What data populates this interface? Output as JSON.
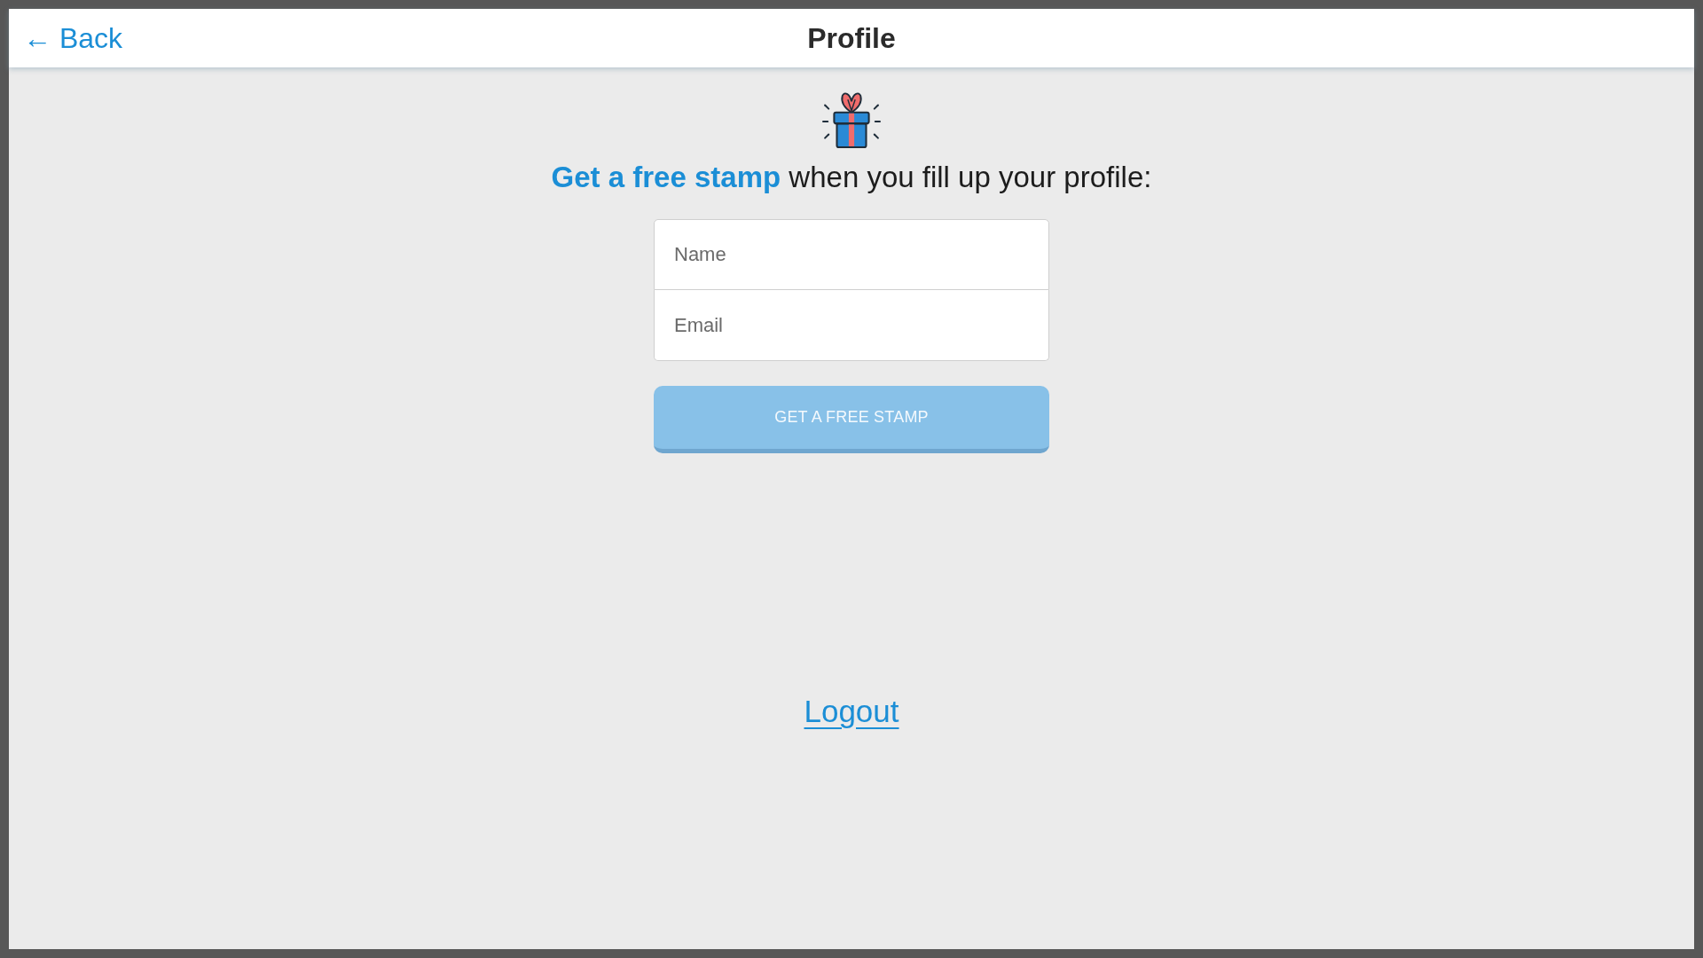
{
  "header": {
    "back_link": "← Back",
    "title": "Profile"
  },
  "promo": {
    "headline": "**Get a free stamp** when you fill up your profile:"
  },
  "form": {
    "fields": [
      {
        "placeholder": "Name"
      },
      {
        "placeholder": "Email"
      }
    ],
    "submit": {
      "label": "GET A FREE STAMP",
      "disabled": true
    }
  },
  "logout": "Logout"
}
